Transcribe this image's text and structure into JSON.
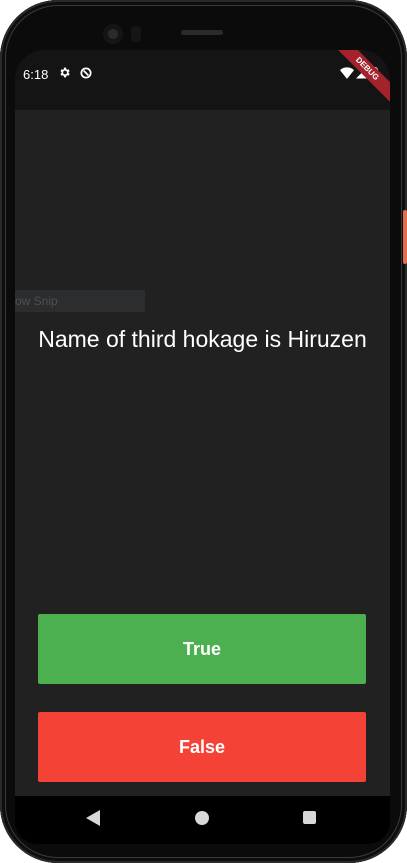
{
  "status_bar": {
    "time": "6:18",
    "icons_left": [
      "gear-icon",
      "sync-icon"
    ],
    "icons_right": [
      "wifi-icon",
      "signal-icon",
      "battery-icon"
    ],
    "debug_banner": "DEBUG"
  },
  "ghost_tooltip": "ow Snip",
  "quiz": {
    "question": "Name of third hokage is Hiruzen",
    "true_label": "True",
    "false_label": "False"
  },
  "colors": {
    "background": "#212121",
    "true_button": "#4caf50",
    "false_button": "#f44336",
    "debug_banner": "#a3222c"
  },
  "nav_bar": {
    "icons": [
      "back-icon",
      "home-icon",
      "recents-icon"
    ]
  }
}
